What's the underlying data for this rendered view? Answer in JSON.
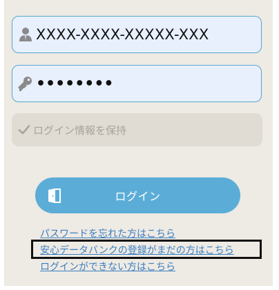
{
  "login_form": {
    "user_id_value": "XXXX-XXXX-XXXXX-XXX",
    "password_value": "••••••••",
    "remember_label": "ログイン情報を保持",
    "login_button_label": "ログイン"
  },
  "links": {
    "forgot_password": "パスワードを忘れた方はこちら",
    "not_registered": "安心データバンクの登録がまだの方はこちら",
    "cannot_login": "ログインができない方はこちら"
  },
  "colors": {
    "panel_background": "#eeeae4",
    "input_background": "#e8f0fe",
    "input_border": "#58a6c9",
    "button_background": "#5badd8",
    "link_color": "#3b7fbf",
    "remember_background": "#e0dcd3",
    "highlight_border": "#111111"
  },
  "icons": {
    "user_field": "user-icon",
    "password_field": "key-icon",
    "remember": "check-icon",
    "login_button": "door-icon"
  }
}
